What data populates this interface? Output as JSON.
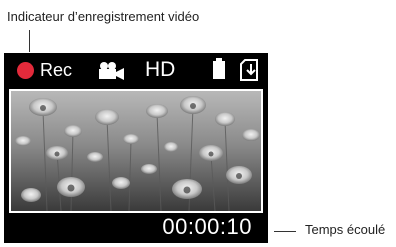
{
  "callouts": {
    "recording_indicator": "Indicateur d’enregistrement vidéo",
    "elapsed_time": "Temps écoulé"
  },
  "statusbar": {
    "rec_label": "Rec",
    "quality_label": "HD",
    "icons": [
      "record-dot-icon",
      "video-camera-icon",
      "battery-icon",
      "memory-card-icon"
    ]
  },
  "timer": "00:00:10",
  "colors": {
    "record_dot": "#e32a3b",
    "screen_bg": "#000000",
    "text_on_screen": "#ffffff"
  }
}
